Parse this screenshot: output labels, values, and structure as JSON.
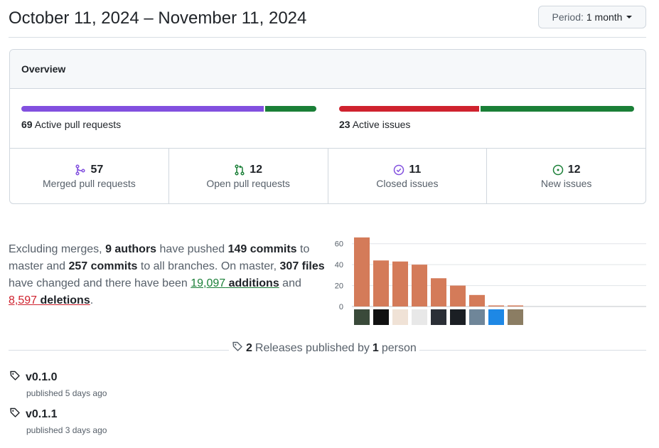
{
  "header": {
    "date_range": "October 11, 2024 – November 11, 2024",
    "period_label": "Period:",
    "period_value": "1 month"
  },
  "overview": {
    "title": "Overview",
    "pull_requests": {
      "count": "69",
      "label": "Active pull requests",
      "merged_fraction": 0.826,
      "colors": [
        "#8250df",
        "#1a7f37"
      ]
    },
    "issues": {
      "count": "23",
      "label": "Active issues",
      "closed_fraction": 0.478,
      "colors": [
        "#cf222e",
        "#1a7f37"
      ]
    },
    "stats": [
      {
        "count": "57",
        "label": "Merged pull requests",
        "icon": "git-merge-icon",
        "color": "#8250df"
      },
      {
        "count": "12",
        "label": "Open pull requests",
        "icon": "git-pull-request-icon",
        "color": "#1a7f37"
      },
      {
        "count": "11",
        "label": "Closed issues",
        "icon": "issue-closed-icon",
        "color": "#8250df"
      },
      {
        "count": "12",
        "label": "New issues",
        "icon": "issue-opened-icon",
        "color": "#1a7f37"
      }
    ]
  },
  "summary": {
    "t1": "Excluding merges, ",
    "authors": "9 authors",
    "t2": " have pushed ",
    "commits_master": "149 commits",
    "t3": " to master and ",
    "commits_all": "257 commits",
    "t4": " to all branches. On master, ",
    "files": "307 files",
    "t5": " have changed and there have been ",
    "additions_num": "19,097",
    "additions_word": " additions",
    "t6": " and ",
    "deletions_num": "8,597",
    "deletions_word": " deletions",
    "t7": "."
  },
  "chart_data": {
    "type": "bar",
    "values": [
      66,
      44,
      43,
      40,
      27,
      20,
      11,
      1,
      1
    ],
    "ylim": [
      0,
      70
    ],
    "yticks": [
      "0",
      "20",
      "40",
      "60"
    ],
    "bar_color": "#d47b59",
    "grid": true
  },
  "releases": {
    "count": "2",
    "t1": " Releases published by ",
    "people": "1",
    "t2": " person",
    "items": [
      {
        "tag": "v0.1.0",
        "published": "published 5 days ago"
      },
      {
        "tag": "v0.1.1",
        "published": "published 3 days ago"
      }
    ]
  }
}
